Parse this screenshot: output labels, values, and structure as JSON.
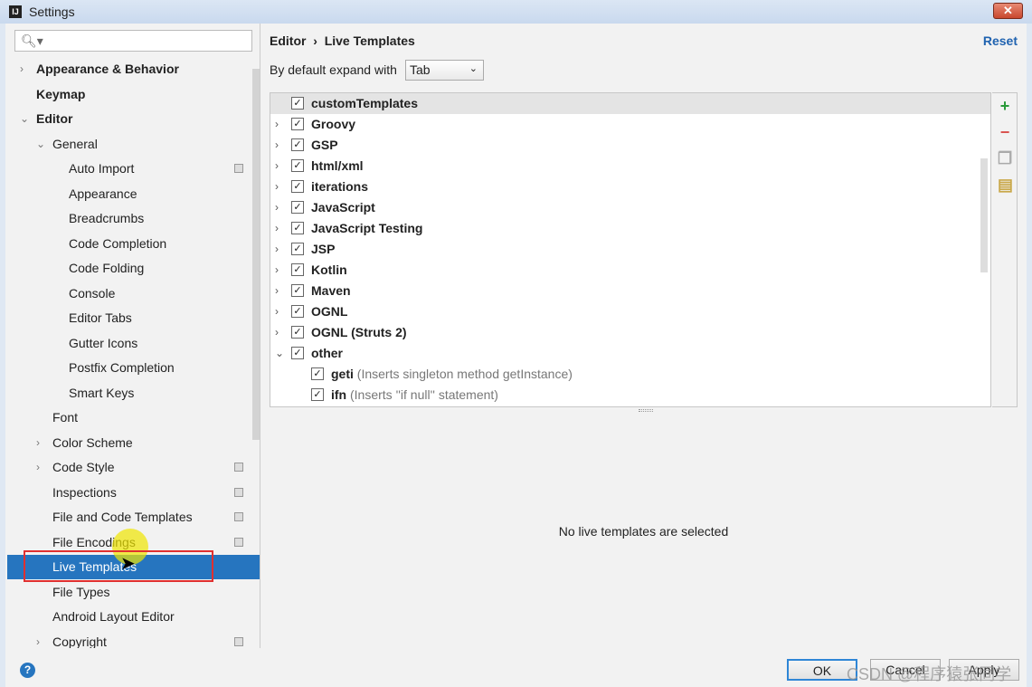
{
  "window": {
    "title": "Settings",
    "close_icon": "close-icon"
  },
  "search": {
    "placeholder": "",
    "icon": "search-icon"
  },
  "sidebar": {
    "items": [
      {
        "label": "Appearance & Behavior",
        "level": 0,
        "arrow": "›",
        "bold": true
      },
      {
        "label": "Keymap",
        "level": 0,
        "bold": true
      },
      {
        "label": "Editor",
        "level": 0,
        "arrow": "⌄",
        "bold": true
      },
      {
        "label": "General",
        "level": 1,
        "arrow": "⌄"
      },
      {
        "label": "Auto Import",
        "level": 2,
        "copy": true
      },
      {
        "label": "Appearance",
        "level": 2
      },
      {
        "label": "Breadcrumbs",
        "level": 2
      },
      {
        "label": "Code Completion",
        "level": 2
      },
      {
        "label": "Code Folding",
        "level": 2
      },
      {
        "label": "Console",
        "level": 2
      },
      {
        "label": "Editor Tabs",
        "level": 2
      },
      {
        "label": "Gutter Icons",
        "level": 2
      },
      {
        "label": "Postfix Completion",
        "level": 2
      },
      {
        "label": "Smart Keys",
        "level": 2
      },
      {
        "label": "Font",
        "level": 1
      },
      {
        "label": "Color Scheme",
        "level": 1,
        "arrow": "›"
      },
      {
        "label": "Code Style",
        "level": 1,
        "arrow": "›",
        "copy": true
      },
      {
        "label": "Inspections",
        "level": 1,
        "copy": true
      },
      {
        "label": "File and Code Templates",
        "level": 1,
        "copy": true
      },
      {
        "label": "File Encodings",
        "level": 1,
        "copy": true
      },
      {
        "label": "Live Templates",
        "level": 1,
        "selected": true
      },
      {
        "label": "File Types",
        "level": 1
      },
      {
        "label": "Android Layout Editor",
        "level": 1
      },
      {
        "label": "Copyright",
        "level": 1,
        "arrow": "›",
        "copy": true
      }
    ]
  },
  "main": {
    "breadcrumb": {
      "parent": "Editor",
      "sep": "›",
      "current": "Live Templates"
    },
    "reset": "Reset",
    "expand_label": "By default expand with",
    "expand_value": "Tab",
    "templates": [
      {
        "label": "customTemplates",
        "checked": true,
        "highlight": true
      },
      {
        "label": "Groovy",
        "checked": true,
        "arrow": "›"
      },
      {
        "label": "GSP",
        "checked": true,
        "arrow": "›"
      },
      {
        "label": "html/xml",
        "checked": true,
        "arrow": "›"
      },
      {
        "label": "iterations",
        "checked": true,
        "arrow": "›"
      },
      {
        "label": "JavaScript",
        "checked": true,
        "arrow": "›"
      },
      {
        "label": "JavaScript Testing",
        "checked": true,
        "arrow": "›"
      },
      {
        "label": "JSP",
        "checked": true,
        "arrow": "›"
      },
      {
        "label": "Kotlin",
        "checked": true,
        "arrow": "›"
      },
      {
        "label": "Maven",
        "checked": true,
        "arrow": "›"
      },
      {
        "label": "OGNL",
        "checked": true,
        "arrow": "›"
      },
      {
        "label": "OGNL (Struts 2)",
        "checked": true,
        "arrow": "›"
      },
      {
        "label": "other",
        "checked": true,
        "arrow": "⌄"
      },
      {
        "label": "geti",
        "desc": "(Inserts singleton method getInstance)",
        "checked": true,
        "child": true
      },
      {
        "label": "ifn",
        "desc": "(Inserts ''if null'' statement)",
        "checked": true,
        "child": true
      }
    ],
    "tools": [
      {
        "icon": "plus-icon",
        "glyph": "+",
        "color": "#2a9a3a"
      },
      {
        "icon": "minus-icon",
        "glyph": "−",
        "color": "#d9534f"
      },
      {
        "icon": "copy-icon",
        "glyph": "❐",
        "color": "#aaa"
      },
      {
        "icon": "template-group-icon",
        "glyph": "▤",
        "color": "#c9a84a"
      }
    ],
    "empty_message": "No live templates are selected"
  },
  "buttons": {
    "ok": "OK",
    "cancel": "Cancel",
    "apply": "Apply",
    "help": "?"
  },
  "watermark": "CSDN @程序猿张同学"
}
